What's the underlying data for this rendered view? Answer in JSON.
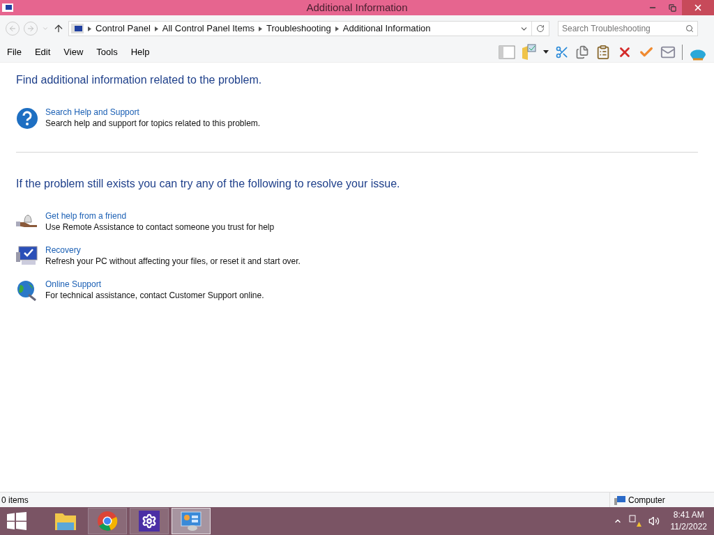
{
  "window": {
    "title": "Additional Information"
  },
  "breadcrumb": [
    "Control Panel",
    "All Control Panel Items",
    "Troubleshooting",
    "Additional Information"
  ],
  "search": {
    "placeholder": "Search Troubleshooting"
  },
  "menu": [
    "File",
    "Edit",
    "View",
    "Tools",
    "Help"
  ],
  "sections": [
    {
      "heading": "Find additional information related to the problem.",
      "items": [
        {
          "kind": "help",
          "title": "Search Help and Support",
          "description": "Search help and support for topics related to this problem."
        }
      ]
    },
    {
      "heading": "If the problem still exists you can try any of the following to resolve your issue.",
      "items": [
        {
          "kind": "friend",
          "title": "Get help from a friend",
          "description": "Use Remote Assistance to contact someone you trust for help"
        },
        {
          "kind": "recovery",
          "title": "Recovery",
          "description": "Refresh your PC without affecting your files, or reset it and start over."
        },
        {
          "kind": "online",
          "title": "Online Support",
          "description": "For technical assistance, contact Customer Support online."
        }
      ]
    }
  ],
  "status_bar": {
    "items": "0 items",
    "zone": "Computer"
  },
  "taskbar": {
    "apps": [
      {
        "kind": "explorer",
        "selected": false
      },
      {
        "kind": "chrome",
        "selected": false
      },
      {
        "kind": "settings",
        "selected": false
      },
      {
        "kind": "control",
        "selected": true
      }
    ],
    "time": "8:41 AM",
    "date": "11/2/2022"
  }
}
